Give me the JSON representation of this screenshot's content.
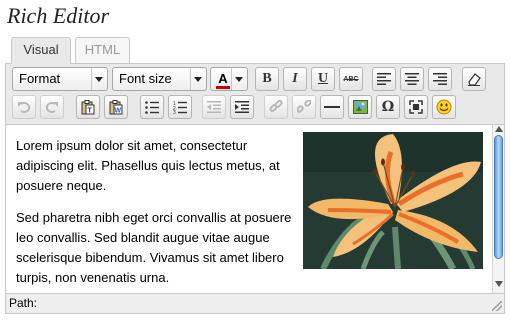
{
  "page": {
    "title": "Rich Editor"
  },
  "tabs": [
    {
      "label": "Visual",
      "active": true
    },
    {
      "label": "HTML",
      "active": false
    }
  ],
  "toolbar": {
    "format_select": "Format",
    "fontsize_select": "Font size",
    "forecolor_glyph": "A",
    "bold": "B",
    "italic": "I",
    "underline": "U",
    "strike": "ABC",
    "omega": "Ω",
    "text_color": "#cc0000",
    "icons": [
      "text-color-icon",
      "bold-icon",
      "italic-icon",
      "underline-icon",
      "strikethrough-icon",
      "align-left-icon",
      "align-center-icon",
      "align-right-icon",
      "eraser-icon",
      "undo-icon",
      "redo-icon",
      "paste-text-icon",
      "paste-word-icon",
      "bullet-list-icon",
      "numbered-list-icon",
      "outdent-icon",
      "indent-icon",
      "link-icon",
      "unlink-icon",
      "horizontal-rule-icon",
      "insert-image-icon",
      "special-character-icon",
      "fullscreen-icon",
      "smiley-icon"
    ]
  },
  "content": {
    "paragraph1": "Lorem ipsum dolor sit amet, consectetur adipiscing elit. Phasellus quis lectus metus, at posuere neque.",
    "paragraph2": "Sed pharetra nibh eget orci convallis at posuere leo convallis. Sed blandit augue vitae augue scelerisque bibendum. Vivamus sit amet libero turpis, non venenatis urna."
  },
  "statusbar": {
    "path_label": "Path:"
  },
  "colors": {
    "accent_scroll": "#5d98da",
    "petal": "#f4c27a",
    "petal_stripe": "#e8702a",
    "image_bg": "#243a33"
  }
}
